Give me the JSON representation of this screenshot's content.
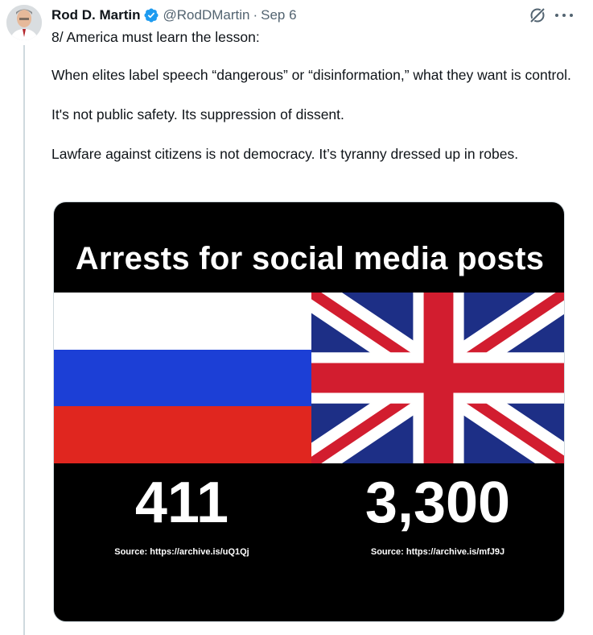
{
  "tweet": {
    "author_name": "Rod D. Martin",
    "handle": "@RodDMartin",
    "separator": "·",
    "date": "Sep 6",
    "text": [
      "8/ America must learn the lesson:",
      "When elites label speech “dangerous” or “disinformation,” what they want is control.",
      "It's not public safety. Its suppression of dissent.",
      "Lawfare against citizens is not democracy. It’s tyranny dressed up in robes."
    ]
  },
  "icons": {
    "verified": "verified-badge-icon",
    "grok": "grok-icon",
    "more": "more-icon"
  },
  "media": {
    "title": "Arrests for social media posts",
    "russia": {
      "count": "411",
      "source": "Source: https://archive.is/uQ1Qj",
      "flag_colors": [
        "#ffffff",
        "#1c3fd6",
        "#e0261f"
      ]
    },
    "uk": {
      "count": "3,300",
      "source": "Source: https://archive.is/mfJ9J",
      "flag_colors": [
        "#1d2f86",
        "#ffffff",
        "#d21d2f"
      ]
    }
  },
  "colors": {
    "verified_blue": "#1d9bf0",
    "text_primary": "#0f1419",
    "text_secondary": "#536471"
  }
}
